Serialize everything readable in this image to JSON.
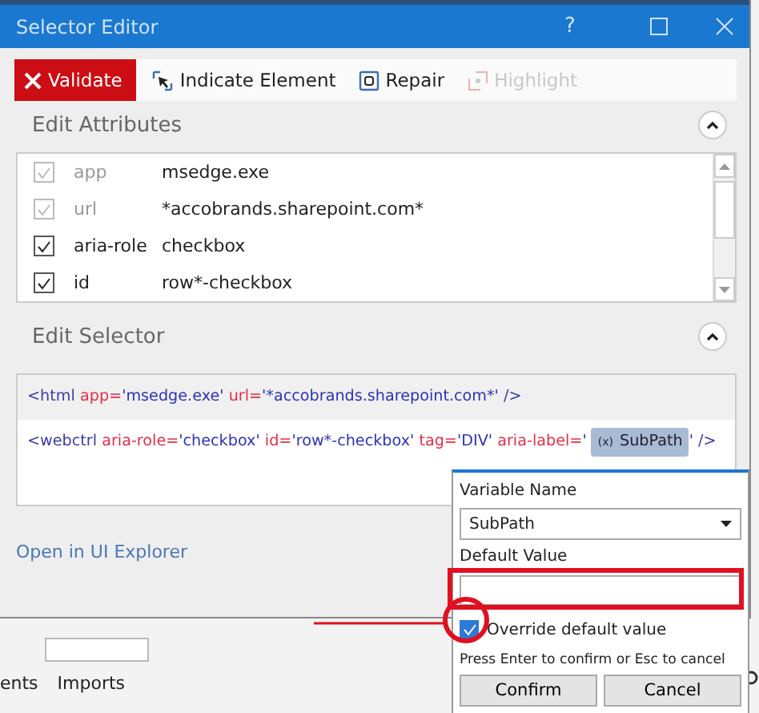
{
  "window": {
    "title": "Selector Editor",
    "help": "?"
  },
  "toolbar": [
    {
      "label": "Validate",
      "kind": "validate",
      "disabled": false
    },
    {
      "label": "Indicate Element",
      "kind": "indicate",
      "disabled": false
    },
    {
      "label": "Repair",
      "kind": "repair",
      "disabled": false
    },
    {
      "label": "Highlight",
      "kind": "highlight",
      "disabled": true
    }
  ],
  "attributes": {
    "title": "Edit Attributes",
    "expanded": true,
    "rows": [
      {
        "name": "app",
        "value": "msedge.exe",
        "checked": true,
        "disabled": true
      },
      {
        "name": "url",
        "value": "*accobrands.sharepoint.com*",
        "checked": true,
        "disabled": true
      },
      {
        "name": "aria-role",
        "value": "checkbox",
        "checked": true,
        "disabled": false
      },
      {
        "name": "id",
        "value": "row*-checkbox",
        "checked": true,
        "disabled": false
      }
    ]
  },
  "selector": {
    "title": "Edit Selector",
    "expanded": true,
    "lines": [
      {
        "selected": true,
        "segments": [
          {
            "kind": "tag",
            "text": "<html"
          },
          {
            "kind": "attr",
            "text": "app="
          },
          {
            "kind": "value",
            "text": "'msedge.exe'"
          },
          {
            "kind": "attr",
            "text": "url="
          },
          {
            "kind": "value",
            "text": "'*accobrands.sharepoint.com*'"
          },
          {
            "kind": "tag",
            "text": "/>"
          }
        ]
      },
      {
        "selected": false,
        "segments": [
          {
            "kind": "tag",
            "text": "<webctrl"
          },
          {
            "kind": "attr",
            "text": "aria-role="
          },
          {
            "kind": "value",
            "text": "'checkbox'"
          },
          {
            "kind": "attr",
            "text": "id="
          },
          {
            "kind": "value",
            "text": "'row*-checkbox'"
          },
          {
            "kind": "attr",
            "text": "tag="
          },
          {
            "kind": "value",
            "text": "'DIV'"
          },
          {
            "kind": "attr",
            "text": "aria-label="
          },
          {
            "kind": "value",
            "text": "'"
          },
          {
            "kind": "var",
            "icon": "(x)",
            "text": "SubPath"
          },
          {
            "kind": "value",
            "text": "'"
          },
          {
            "kind": "tag",
            "text": "/>"
          }
        ]
      }
    ]
  },
  "link": "Open in UI Explorer",
  "popup": {
    "variable_label": "Variable Name",
    "variable_value": "SubPath",
    "default_label": "Default Value",
    "override": {
      "label": "Override default value",
      "checked": true
    },
    "hint": "Press Enter to confirm or Esc to cancel",
    "buttons": [
      "Confirm",
      "Cancel"
    ]
  },
  "background_tabs": [
    "ents",
    "Imports"
  ]
}
